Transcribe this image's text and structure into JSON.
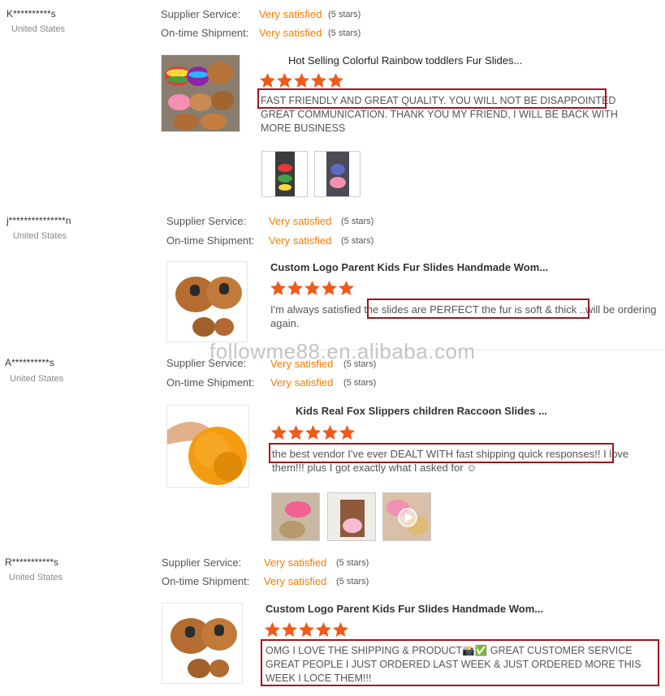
{
  "labels": {
    "supplier_service": "Supplier Service:",
    "ontime_shipment": "On-time Shipment:"
  },
  "watermark": "followme88.en.alibaba.com",
  "colors": {
    "accent": "#f57c00",
    "highlight_border": "#a0141e"
  },
  "reviews": [
    {
      "buyer": "K**********s",
      "country": "United States",
      "supplier_value": "Very satisfied",
      "supplier_stars": "(5 stars)",
      "shipment_value": "Very satisfied",
      "shipment_stars": "(5 stars)",
      "product_title": "Hot Selling Colorful Rainbow toddlers Fur Slides...",
      "rating": 5,
      "review_part1": "FAST FRIENDLY AND GREAT QUALITY. YOU WILL NOT BE DISAPPOINTED",
      "review_part2": " GREAT COMMUNICATION. THANK YOU MY FRIEND, I WILL BE BACK WITH MORE BUSINESS"
    },
    {
      "buyer": "j***************n",
      "country": "United States",
      "supplier_value": "Very satisfied",
      "supplier_stars": "(5 stars)",
      "shipment_value": "Very satisfied",
      "shipment_stars": "(5 stars)",
      "product_title": "Custom Logo Parent Kids Fur Slides Handmade Wom...",
      "rating": 5,
      "review_part0": "I'm always satisfied ",
      "review_part1": "the slides are PERFECT the fur is soft & thick",
      "review_part2": " ..will be ordering again."
    },
    {
      "buyer": "A**********s",
      "country": "United States",
      "supplier_value": "Very satisfied",
      "supplier_stars": "(5 stars)",
      "shipment_value": "Very satisfied",
      "shipment_stars": "(5 stars)",
      "product_title": "Kids Real Fox Slippers children Raccoon Slides ...",
      "rating": 5,
      "review_part1": "the best vendor I've ever DEALT WITH fast shipping quick responses!!",
      "review_part2": " I love them!!! plus I got exactly what I asked for ☺"
    },
    {
      "buyer": "R***********s",
      "country": "United States",
      "supplier_value": "Very satisfied",
      "supplier_stars": "(5 stars)",
      "shipment_value": "Very satisfied",
      "shipment_stars": "(5 stars)",
      "product_title": "Custom Logo Parent Kids Fur Slides Handmade Wom...",
      "rating": 5,
      "review_part1": "OMG I LOVE THE SHIPPING & PRODUCT📸✅ GREAT CUSTOMER SERVICE GREAT PEOPLE I JUST ORDERED LAST WEEK & JUST ORDERED MORE THIS WEEK I LOCE THEM!!!"
    }
  ]
}
